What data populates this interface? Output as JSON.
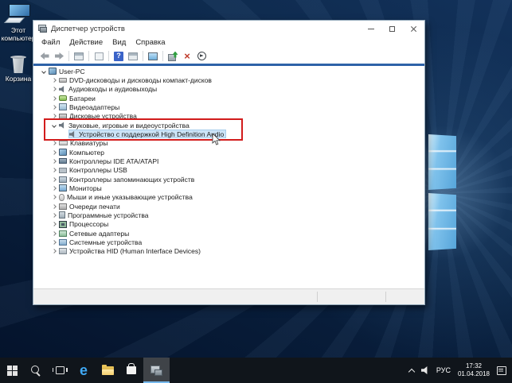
{
  "desktop": {
    "icons": [
      {
        "name": "this-pc",
        "label": "Этот компьютер"
      },
      {
        "name": "recycle-bin",
        "label": "Корзина"
      }
    ]
  },
  "window": {
    "title": "Диспетчер устройств",
    "menu": [
      "Файл",
      "Действие",
      "Вид",
      "Справка"
    ],
    "toolbar": [
      "back",
      "forward",
      "sep",
      "console",
      "sep",
      "export-list",
      "sep",
      "help",
      "properties",
      "sep",
      "computer-view",
      "sep",
      "update-driver",
      "uninstall-device",
      "scan-hardware"
    ],
    "toolbar_glyphs": {
      "help": "?",
      "uninstall-device": "×"
    },
    "tree": [
      {
        "label": "User-PC",
        "depth": 0,
        "icon": "computer",
        "chevron": "expanded"
      },
      {
        "label": "DVD-дисководы и дисководы компакт-дисков",
        "depth": 1,
        "icon": "dvd-drive",
        "chevron": "collapsed"
      },
      {
        "label": "Аудиовходы и аудиовыходы",
        "depth": 1,
        "icon": "audio",
        "chevron": "collapsed"
      },
      {
        "label": "Батареи",
        "depth": 1,
        "icon": "battery",
        "chevron": "collapsed"
      },
      {
        "label": "Видеоадаптеры",
        "depth": 1,
        "icon": "display-adapter",
        "chevron": "collapsed"
      },
      {
        "label": "Дисковые устройства",
        "depth": 1,
        "icon": "disk-drive",
        "chevron": "collapsed"
      },
      {
        "label": "Звуковые, игровые и видеоустройства",
        "depth": 1,
        "icon": "sound-device",
        "chevron": "expanded",
        "boxed": true
      },
      {
        "label": "Устройство с поддержкой High Definition Audio",
        "depth": 2,
        "icon": "sound-device",
        "chevron": "none",
        "selected": true,
        "boxed": true
      },
      {
        "label": "Клавиатуры",
        "depth": 1,
        "icon": "keyboard",
        "chevron": "collapsed"
      },
      {
        "label": "Компьютер",
        "depth": 1,
        "icon": "computer",
        "chevron": "collapsed"
      },
      {
        "label": "Контроллеры IDE ATA/ATAPI",
        "depth": 1,
        "icon": "ide-controller",
        "chevron": "collapsed"
      },
      {
        "label": "Контроллеры USB",
        "depth": 1,
        "icon": "usb-controller",
        "chevron": "collapsed"
      },
      {
        "label": "Контроллеры запоминающих устройств",
        "depth": 1,
        "icon": "storage-controller",
        "chevron": "collapsed"
      },
      {
        "label": "Мониторы",
        "depth": 1,
        "icon": "monitor",
        "chevron": "collapsed"
      },
      {
        "label": "Мыши и иные указывающие устройства",
        "depth": 1,
        "icon": "mouse",
        "chevron": "collapsed"
      },
      {
        "label": "Очереди печати",
        "depth": 1,
        "icon": "print-queue",
        "chevron": "collapsed"
      },
      {
        "label": "Программные устройства",
        "depth": 1,
        "icon": "software-device",
        "chevron": "collapsed"
      },
      {
        "label": "Процессоры",
        "depth": 1,
        "icon": "processor",
        "chevron": "collapsed"
      },
      {
        "label": "Сетевые адаптеры",
        "depth": 1,
        "icon": "network-adapter",
        "chevron": "collapsed"
      },
      {
        "label": "Системные устройства",
        "depth": 1,
        "icon": "system-device",
        "chevron": "collapsed"
      },
      {
        "label": "Устройства HID (Human Interface Devices)",
        "depth": 1,
        "icon": "hid-device",
        "chevron": "collapsed"
      }
    ]
  },
  "taskbar": {
    "items": [
      {
        "name": "start"
      },
      {
        "name": "search"
      },
      {
        "name": "task-view"
      },
      {
        "name": "edge",
        "glyph": "e"
      },
      {
        "name": "file-explorer"
      },
      {
        "name": "store"
      },
      {
        "name": "device-manager",
        "active": true
      }
    ],
    "tray": {
      "language": "РУС",
      "time": "17:32",
      "date": "01.04.2018"
    }
  },
  "colors": {
    "selection": "#cce4f7",
    "highlight_box": "#d21c1c",
    "accent_line": "#2e62a8",
    "taskbar_active_underline": "#76b9ed"
  }
}
